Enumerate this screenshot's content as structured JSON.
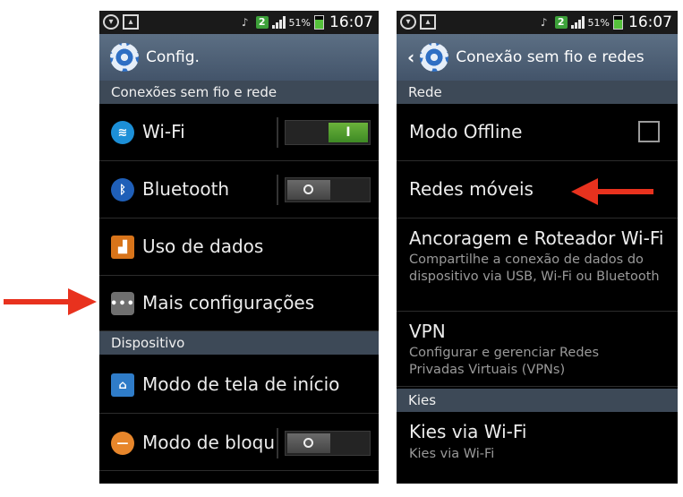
{
  "left": {
    "status": {
      "badge": "2",
      "battery_pct": "51%",
      "time": "16:07"
    },
    "title": "Config.",
    "section1": "Conexões sem fio e rede",
    "wifi": "Wi-Fi",
    "wifi_toggle_on": "I",
    "bluetooth": "Bluetooth",
    "data_usage": "Uso de dados",
    "more": "Mais configurações",
    "section2": "Dispositivo",
    "home_mode": "Modo de tela de início",
    "block_mode": "Modo de bloqu"
  },
  "right": {
    "status": {
      "badge": "2",
      "battery_pct": "51%",
      "time": "16:07"
    },
    "title": "Conexão sem fio e redes",
    "section1": "Rede",
    "offline": "Modo Offline",
    "mobile_networks": "Redes móveis",
    "tethering": "Ancoragem e Roteador Wi-Fi",
    "tethering_desc": "Compartilhe a conexão de dados do dispositivo via USB, Wi-Fi ou Bluetooth",
    "vpn": "VPN",
    "vpn_desc": "Configurar e gerenciar Redes Privadas Virtuais (VPNs)",
    "section2": "Kies",
    "kies": "Kies via Wi-Fi",
    "kies_desc": "Kies via Wi-Fi"
  },
  "colors": {
    "arrow": "#e8321e",
    "header_bg": "#3d4957",
    "toggle_on": "#4f9e2c"
  },
  "icons": [
    "wifi-icon",
    "bluetooth-icon",
    "data-usage-icon",
    "more-icon",
    "home-screen-icon",
    "block-mode-icon",
    "gear-icon"
  ]
}
